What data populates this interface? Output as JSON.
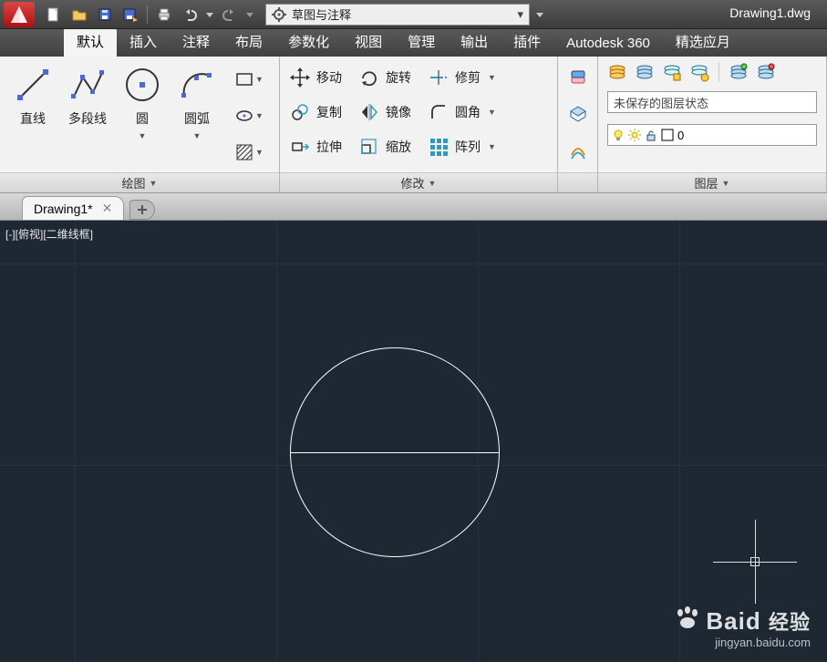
{
  "title": {
    "doc": "Drawing1.dwg"
  },
  "workspace": {
    "label": "草图与注释"
  },
  "tabs": {
    "items": [
      "默认",
      "插入",
      "注释",
      "布局",
      "参数化",
      "视图",
      "管理",
      "输出",
      "插件",
      "Autodesk 360",
      "精选应月"
    ],
    "active": 0
  },
  "panels": {
    "draw": {
      "title": "绘图",
      "line": "直线",
      "polyline": "多段线",
      "circle": "圆",
      "arc": "圆弧"
    },
    "modify": {
      "title": "修改",
      "move": "移动",
      "rotate": "旋转",
      "trim": "修剪",
      "copy": "复制",
      "mirror": "镜像",
      "fillet": "圆角",
      "stretch": "拉伸",
      "scale": "缩放",
      "array": "阵列"
    },
    "layers": {
      "title": "图层",
      "state": "未保存的图层状态",
      "current": "0"
    }
  },
  "doctabs": {
    "active": "Drawing1*"
  },
  "viewport": {
    "label": "[-][俯视][二维线框]"
  },
  "watermark": {
    "brand_en": "Bai",
    "brand_char": "d",
    "brand_cn": "经验",
    "url": "jingyan.baidu.com"
  }
}
